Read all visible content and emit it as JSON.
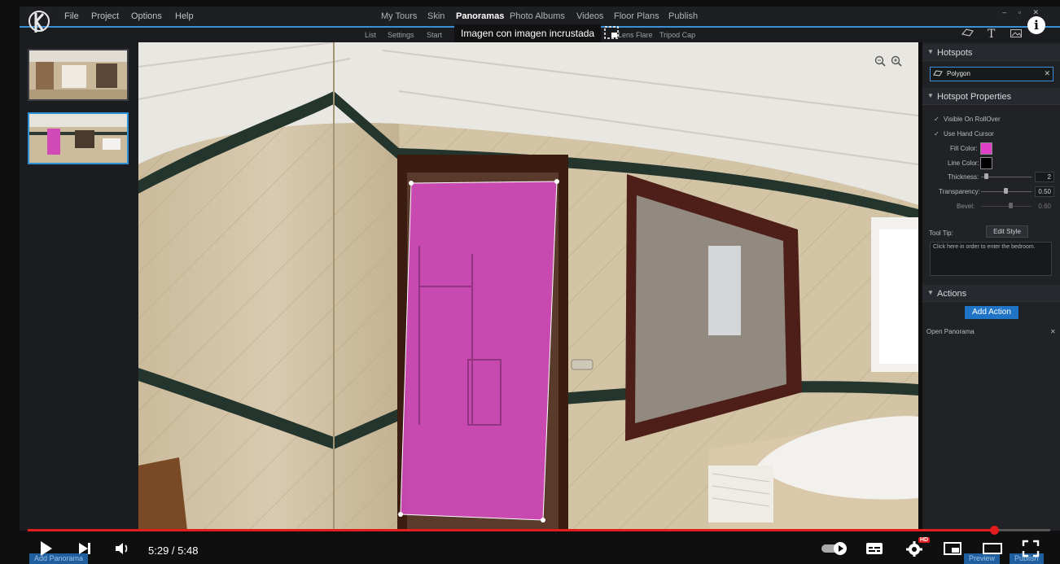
{
  "app": {
    "menu": [
      "File",
      "Project",
      "Options",
      "Help"
    ],
    "nav": [
      "My Tours",
      "Skin",
      "Panoramas",
      "Photo Albums",
      "Videos",
      "Floor Plans",
      "Publish"
    ],
    "nav_active": "Panoramas",
    "subnav": [
      "List",
      "Settings",
      "Start",
      "Lens Flare",
      "Tripod Cap"
    ]
  },
  "pip_tooltip": "Imagen con imagen incrustada",
  "right_panel": {
    "hotspots_header": "Hotspots",
    "hotspot_value": "Polygon",
    "properties_header": "Hotspot Properties",
    "visible_rollover": "Visible On RollOver",
    "hand_cursor": "Use Hand Cursor",
    "fill_color_label": "Fill Color:",
    "line_color_label": "Line Color:",
    "thickness_label": "Thickness:",
    "thickness_value": "2",
    "transparency_label": "Transparency:",
    "transparency_value": "0.50",
    "bevel_label": "Bevel:",
    "bevel_value": "0.60",
    "tooltip_label": "Tool Tip:",
    "edit_style": "Edit Style",
    "tooltip_text": "Click here in order to enter the bedroom.",
    "actions_header": "Actions",
    "add_action": "Add Action",
    "action_item": "Open Panorama"
  },
  "colors": {
    "fill_color": "#e040c8",
    "line_color": "#000000",
    "accent": "#3b8fd6",
    "progress": "#e21d1d"
  },
  "player": {
    "current": "5:29",
    "duration": "5:48",
    "timecode": "5:29 / 5:48",
    "progress_fraction": 0.945,
    "quality_badge": "HD"
  },
  "bottom_ghost": {
    "add_panorama": "Add Panorama",
    "preview": "Preview",
    "publish": "Publish"
  },
  "icons": [
    "logo-icon",
    "zoom-out-icon",
    "zoom-in-icon",
    "polygon-tool-icon",
    "text-tool-icon",
    "image-tool-icon",
    "info-icon",
    "pip-icon",
    "play-icon",
    "next-icon",
    "volume-icon",
    "autoplay-toggle-icon",
    "subtitles-icon",
    "settings-icon",
    "miniplayer-icon",
    "theater-icon",
    "fullscreen-icon"
  ]
}
